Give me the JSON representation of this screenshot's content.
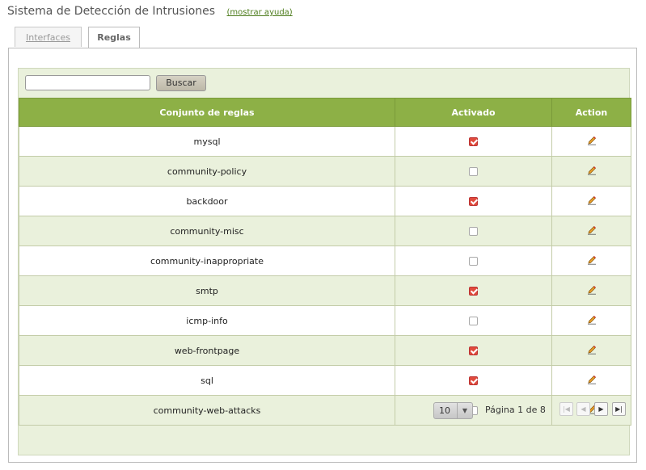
{
  "page": {
    "title": "Sistema de Detección de Intrusiones",
    "help_link": "(mostrar ayuda)"
  },
  "tabs": [
    {
      "label": "Interfaces",
      "active": false
    },
    {
      "label": "Reglas",
      "active": true
    }
  ],
  "search": {
    "value": "",
    "placeholder": "",
    "button_label": "Buscar"
  },
  "table": {
    "columns": [
      "Conjunto de reglas",
      "Activado",
      "Action"
    ],
    "rows": [
      {
        "name": "mysql",
        "enabled": true
      },
      {
        "name": "community-policy",
        "enabled": false
      },
      {
        "name": "backdoor",
        "enabled": true
      },
      {
        "name": "community-misc",
        "enabled": false
      },
      {
        "name": "community-inappropriate",
        "enabled": false
      },
      {
        "name": "smtp",
        "enabled": true
      },
      {
        "name": "icmp-info",
        "enabled": false
      },
      {
        "name": "web-frontpage",
        "enabled": true
      },
      {
        "name": "sql",
        "enabled": true
      },
      {
        "name": "community-web-attacks",
        "enabled": false
      }
    ],
    "action_icon": "pencil-edit-icon"
  },
  "pagination": {
    "page_size": "10",
    "page_info": "Página 1 de 8"
  },
  "colors": {
    "header_green": "#8db046",
    "row_alt": "#eaf1dc",
    "checked_red": "#e04a3c",
    "link_green": "#4d7c1c"
  }
}
